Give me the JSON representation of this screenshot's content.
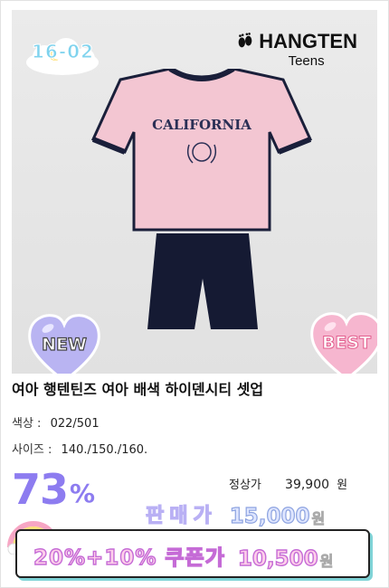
{
  "badge": {
    "code": "16-02"
  },
  "brand": {
    "main": "HANGTEN",
    "sub": "Teens"
  },
  "tshirt": {
    "print_main": "CALIFORNIA"
  },
  "hearts": {
    "new_label": "NEW",
    "best_label": "BEST"
  },
  "product": {
    "title": "여아 행텐틴즈 여아 배색 하이덴시티 셋업",
    "color_label": "색상 :",
    "color_value": "022/501",
    "size_label": "사이즈 :",
    "size_value": "140./150./160."
  },
  "pricing": {
    "discount_number": "73",
    "discount_unit": "%",
    "regular_label": "정상가",
    "regular_value": "39,900",
    "regular_unit": "원",
    "sale_label": "판매가",
    "sale_value": "15,000",
    "sale_unit": "원",
    "coupon_label": "20%+10% 쿠폰가",
    "coupon_value": "10,500",
    "coupon_unit": "원"
  },
  "colors": {
    "accent_purple": "#8d7cf0",
    "tshirt_pink": "#f3c6d2",
    "shorts_navy": "#151a33",
    "new_heart": "#b9b4f2",
    "best_heart": "#f6b6cf"
  }
}
